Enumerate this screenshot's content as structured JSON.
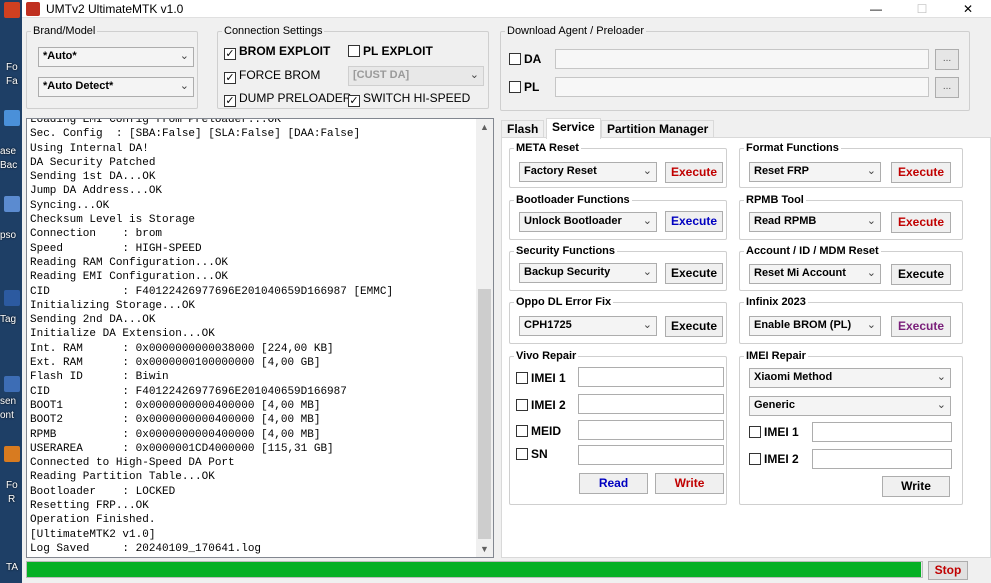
{
  "colors": {
    "execute_red": "#c00000",
    "execute_blue": "#0000c0",
    "execute_black": "#000000",
    "execute_purple": "#7a1f7a",
    "read_blue": "#0000c0",
    "write_red": "#c00000",
    "stop_red": "#c00000",
    "progress_green": "#06b025"
  },
  "window": {
    "title": "UMTv2 UltimateMTK v1.0",
    "minimize": "—",
    "maximize": "☐",
    "close": "✕"
  },
  "desktop": {
    "labels": [
      "Fo",
      "Fa",
      "ase",
      "Bac",
      "pso",
      "Tag",
      "sen",
      "ont",
      "Fo",
      "R",
      "TA"
    ]
  },
  "brand_model": {
    "legend": "Brand/Model",
    "brand": "*Auto*",
    "model": "*Auto Detect*"
  },
  "connection": {
    "legend": "Connection Settings",
    "brom_exploit": {
      "label": "BROM EXPLOIT",
      "checked": true
    },
    "pl_exploit": {
      "label": "PL EXPLOIT",
      "checked": false
    },
    "force_brom": {
      "label": "FORCE BROM",
      "checked": true
    },
    "cust_da": "[CUST DA]",
    "dump_preloader": {
      "label": "DUMP PRELOADER",
      "checked": true
    },
    "switch_highspeed": {
      "label": "SWITCH HI-SPEED",
      "checked": true
    }
  },
  "download_agent": {
    "legend": "Download Agent / Preloader",
    "da_label": "DA",
    "pl_label": "PL",
    "browse": "..."
  },
  "log": {
    "lines": [
      "Loading EMI Config from Preloader...OK",
      "Sec. Config  : [SBA:False] [SLA:False] [DAA:False]",
      "Using Internal DA!",
      "DA Security Patched",
      "Sending 1st DA...OK",
      "Jump DA Address...OK",
      "Syncing...OK",
      "Checksum Level is Storage",
      "Connection    : brom",
      "Speed         : HIGH-SPEED",
      "Reading RAM Configuration...OK",
      "Reading EMI Configuration...OK",
      "CID           : F40122426977696E201040659D166987 [EMMC]",
      "Initializing Storage...OK",
      "Sending 2nd DA...OK",
      "Initialize DA Extension...OK",
      "Int. RAM      : 0x0000000000038000 [224,00 KB]",
      "Ext. RAM      : 0x0000000100000000 [4,00 GB]",
      "Flash ID      : Biwin",
      "CID           : F40122426977696E201040659D166987",
      "BOOT1         : 0x0000000000400000 [4,00 MB]",
      "BOOT2         : 0x0000000000400000 [4,00 MB]",
      "RPMB          : 0x0000000000400000 [4,00 MB]",
      "USERAREA      : 0x0000001CD4000000 [115,31 GB]",
      "Connected to High-Speed DA Port",
      "Reading Partition Table...OK",
      "Bootloader    : LOCKED",
      "Resetting FRP...OK",
      "Operation Finished.",
      "[UltimateMTK2 v1.0]",
      "Log Saved     : 20240109_170641.log"
    ]
  },
  "tabs": [
    {
      "label": "Flash"
    },
    {
      "label": "Service",
      "active": true
    },
    {
      "label": "Partition Manager"
    }
  ],
  "service": {
    "meta_reset": {
      "legend": "META Reset",
      "option": "Factory Reset",
      "button": "Execute"
    },
    "format_functions": {
      "legend": "Format Functions",
      "option": "Reset FRP",
      "button": "Execute"
    },
    "bootloader_functions": {
      "legend": "Bootloader Functions",
      "option": "Unlock Bootloader",
      "button": "Execute"
    },
    "rpmb_tool": {
      "legend": "RPMB Tool",
      "option": "Read RPMB",
      "button": "Execute"
    },
    "security_functions": {
      "legend": "Security Functions",
      "option": "Backup Security",
      "button": "Execute"
    },
    "account_reset": {
      "legend": "Account / ID / MDM Reset",
      "option": "Reset Mi Account",
      "button": "Execute"
    },
    "oppo_dl": {
      "legend": "Oppo DL Error Fix",
      "option": "CPH1725",
      "button": "Execute"
    },
    "infinix": {
      "legend": "Infinix 2023",
      "option": "Enable BROM (PL)",
      "button": "Execute"
    },
    "vivo_repair": {
      "legend": "Vivo Repair",
      "fields": [
        "IMEI 1",
        "IMEI 2",
        "MEID",
        "SN"
      ],
      "read": "Read",
      "write": "Write"
    },
    "imei_repair": {
      "legend": "IMEI Repair",
      "method": "Xiaomi Method",
      "type": "Generic",
      "fields": [
        "IMEI 1",
        "IMEI 2"
      ],
      "write": "Write"
    }
  },
  "status": {
    "progress": 0.999,
    "stop": "Stop"
  }
}
